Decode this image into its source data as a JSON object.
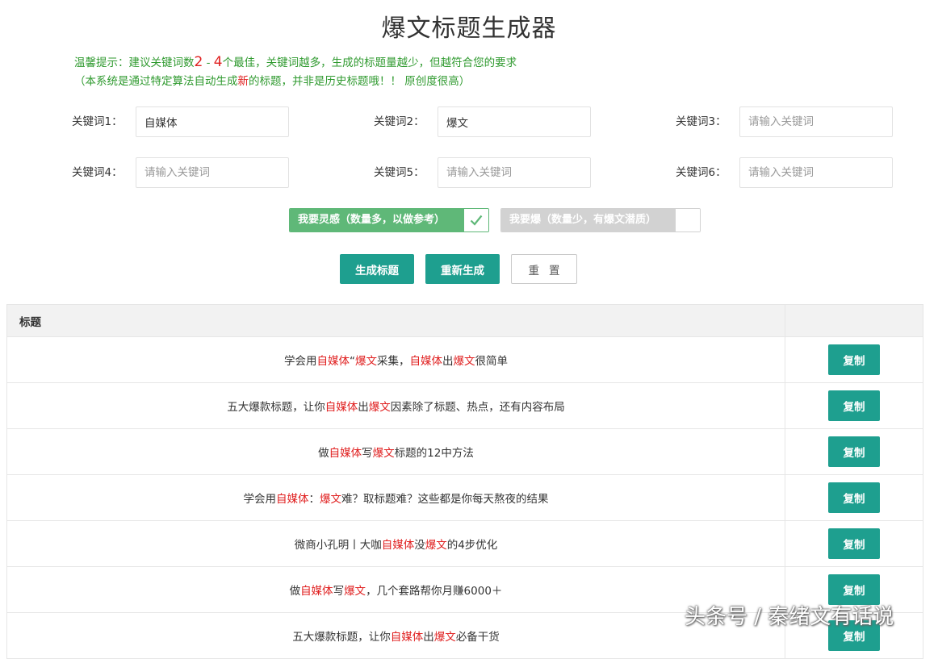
{
  "header": {
    "title": "爆文标题生成器"
  },
  "tips": {
    "line1_prefix": "温馨提示：建议关键词数",
    "line1_range_from": "2",
    "line1_dash": " - ",
    "line1_range_to": "4",
    "line1_suffix": "个最佳，关键词越多，生成的标题量越少，但越符合您的要求",
    "line2_prefix": "（本系统是通过特定算法自动生成",
    "line2_highlight": "新",
    "line2_suffix": "的标题，并非是历史标题哦！！ 原创度很高）"
  },
  "keywords": [
    {
      "label": "关键词1：",
      "value": "自媒体",
      "placeholder": "请输入关键词"
    },
    {
      "label": "关键词2：",
      "value": "爆文",
      "placeholder": "请输入关键词"
    },
    {
      "label": "关键词3：",
      "value": "",
      "placeholder": "请输入关键词"
    },
    {
      "label": "关键词4：",
      "value": "",
      "placeholder": "请输入关键词"
    },
    {
      "label": "关键词5：",
      "value": "",
      "placeholder": "请输入关键词"
    },
    {
      "label": "关键词6：",
      "value": "",
      "placeholder": "请输入关键词"
    }
  ],
  "modes": {
    "inspiration": {
      "label": "我要灵感（数量多，以做参考）",
      "checked": true
    },
    "viral": {
      "label": "我要爆（数量少，有爆文潜质）",
      "checked": false
    }
  },
  "buttons": {
    "generate": "生成标题",
    "regenerate": "重新生成",
    "reset": "重置"
  },
  "table": {
    "header_title": "标题",
    "header_action": "",
    "copy_label": "复制",
    "rows": [
      [
        {
          "t": "学会用",
          "h": false
        },
        {
          "t": "自媒体",
          "h": true
        },
        {
          "t": "“",
          "h": false
        },
        {
          "t": "爆文",
          "h": true
        },
        {
          "t": "采集，",
          "h": false
        },
        {
          "t": "自媒体",
          "h": true
        },
        {
          "t": "出",
          "h": false
        },
        {
          "t": "爆文",
          "h": true
        },
        {
          "t": "很简单",
          "h": false
        }
      ],
      [
        {
          "t": "五大爆款标题，让你",
          "h": false
        },
        {
          "t": "自媒体",
          "h": true
        },
        {
          "t": "出",
          "h": false
        },
        {
          "t": "爆文",
          "h": true
        },
        {
          "t": "因素除了标题、热点，还有内容布局",
          "h": false
        }
      ],
      [
        {
          "t": "做",
          "h": false
        },
        {
          "t": "自媒体",
          "h": true
        },
        {
          "t": "写",
          "h": false
        },
        {
          "t": "爆文",
          "h": true
        },
        {
          "t": "标题的12中方法",
          "h": false
        }
      ],
      [
        {
          "t": "学会用",
          "h": false
        },
        {
          "t": "自媒体",
          "h": true
        },
        {
          "t": "：",
          "h": false
        },
        {
          "t": "爆文",
          "h": true
        },
        {
          "t": "难？取标题难？这些都是你每天熬夜的结果",
          "h": false
        }
      ],
      [
        {
          "t": "微商小孔明丨大咖",
          "h": false
        },
        {
          "t": "自媒体",
          "h": true
        },
        {
          "t": "没",
          "h": false
        },
        {
          "t": "爆文",
          "h": true
        },
        {
          "t": "的4步优化",
          "h": false
        }
      ],
      [
        {
          "t": "做",
          "h": false
        },
        {
          "t": "自媒体",
          "h": true
        },
        {
          "t": "写",
          "h": false
        },
        {
          "t": "爆文",
          "h": true
        },
        {
          "t": "，几个套路帮你月赚6000＋",
          "h": false
        }
      ],
      [
        {
          "t": "五大爆款标题，让你",
          "h": false
        },
        {
          "t": "自媒体",
          "h": true
        },
        {
          "t": "出",
          "h": false
        },
        {
          "t": "爆文",
          "h": true
        },
        {
          "t": "必备干货",
          "h": false
        }
      ]
    ]
  },
  "watermark": "头条号 / 秦绪文有话说",
  "colors": {
    "accent": "#1e9f8f",
    "toggle_on": "#5fb878",
    "toggle_off": "#d2d2d2",
    "tip_green": "#2f9a2f",
    "highlight_red": "#e02020"
  }
}
